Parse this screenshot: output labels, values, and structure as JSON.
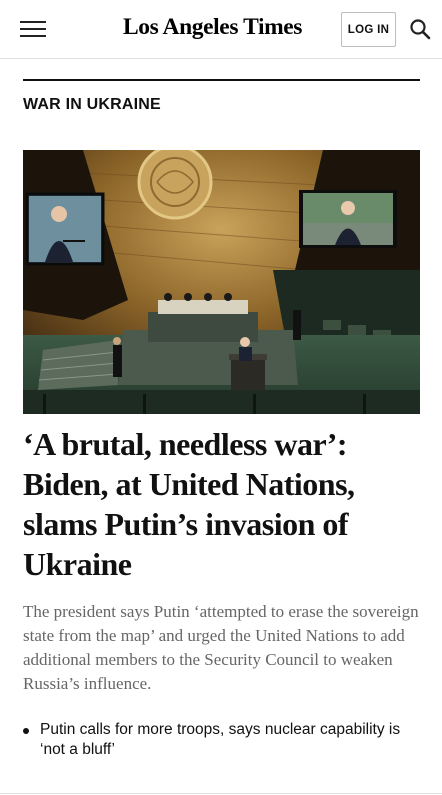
{
  "header": {
    "logo_text": "Los Angeles Times",
    "login_label": "LOG IN",
    "menu_icon": "hamburger-menu-icon",
    "search_icon": "search-icon"
  },
  "section": {
    "label": "WAR IN UKRAINE"
  },
  "article": {
    "headline": "‘A brutal, needless war’: Biden, at United Nations, slams Putin’s invasion of Ukraine",
    "dek": "The president says Putin ‘attempted to erase the sovereign state from the map’ and urged the United Nations to add additional members to the Security Council to weaken Russia’s influence.",
    "related": [
      {
        "text": "Putin calls for more troops, says nuclear capability is ‘not a bluff’"
      }
    ]
  },
  "colors": {
    "accent": "#111111",
    "dek_text": "#666666",
    "divider": "#e1e1e1"
  }
}
